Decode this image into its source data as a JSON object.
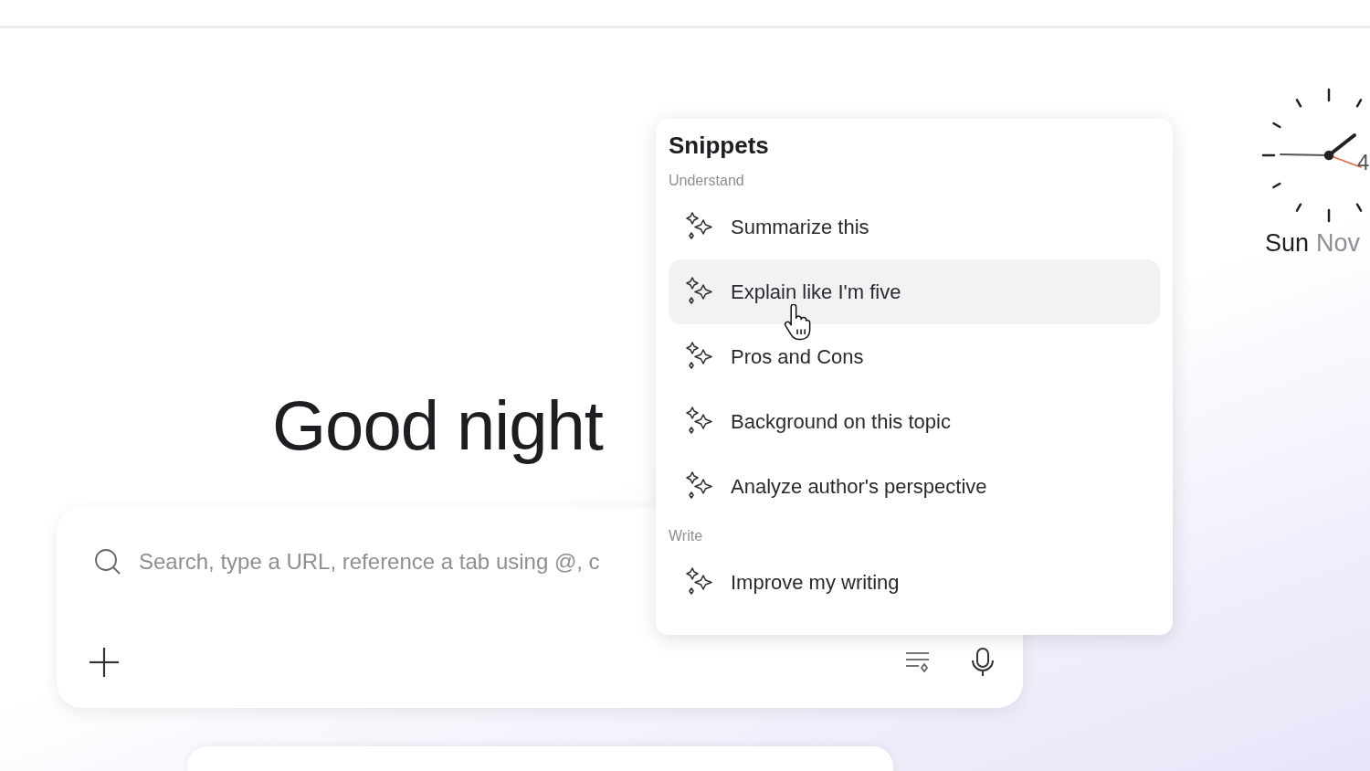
{
  "greeting": "Good night",
  "search": {
    "placeholder": "Search, type a URL, reference a tab using @, c"
  },
  "snippets": {
    "title": "Snippets",
    "groups": [
      {
        "label": "Understand",
        "items": [
          {
            "label": "Summarize this",
            "hovered": false
          },
          {
            "label": "Explain like I'm five",
            "hovered": true
          },
          {
            "label": "Pros and Cons",
            "hovered": false
          },
          {
            "label": "Background on this topic",
            "hovered": false
          },
          {
            "label": "Analyze author's perspective",
            "hovered": false
          }
        ]
      },
      {
        "label": "Write",
        "items": [
          {
            "label": "Improve my writing",
            "hovered": false
          }
        ]
      }
    ]
  },
  "clock": {
    "numeral": "4",
    "day": "Sun",
    "month": "Nov"
  }
}
